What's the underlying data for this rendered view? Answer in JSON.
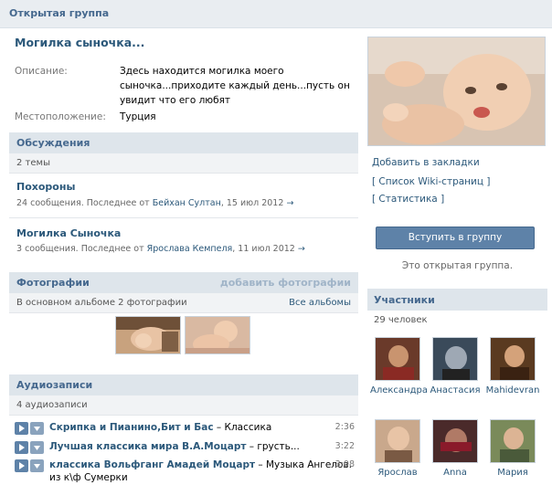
{
  "header": {
    "title": "Открытая группа"
  },
  "group": {
    "name": "Могилка сыночка...",
    "description_label": "Описание:",
    "description_lines": [
      "Здесь находится могилка моего",
      "сыночка...приходите каждый день...пусть он",
      "увидит что его любят"
    ],
    "location_label": "Местоположение:",
    "location": "Турция"
  },
  "discussions": {
    "title": "Обсуждения",
    "count": "2 темы",
    "topics": [
      {
        "title": "Похороны",
        "meta_prefix": "24 сообщения. Последнее от ",
        "author": "Бейхан Султан",
        "date": ", 15 июл 2012",
        "arrow": "→"
      },
      {
        "title": "Могилка Сыночка",
        "meta_prefix": "3 сообщения. Последнее от ",
        "author": "Ярослава Кемпеля",
        "date": ", 11 июл 2012",
        "arrow": "→"
      }
    ]
  },
  "photos": {
    "title": "Фотографии",
    "add_label": "добавить фотографии",
    "summary": "В основном альбоме 2 фотографии",
    "all_label": "Все альбомы"
  },
  "audio": {
    "title": "Аудиозаписи",
    "count": "4 аудиозаписи",
    "tracks": [
      {
        "artist": "Скрипка и Пианино,Бит и Бас",
        "title": " – Классика",
        "duration": "2:36"
      },
      {
        "artist": "Лучшая классика мира В.А.Моцарт",
        "title": " – грусть...",
        "duration": "3:22"
      },
      {
        "artist": "классика Вольфганг Амадей Моцарт",
        "title": " – Музыка Ангелов.",
        "duration": "3:08",
        "extra": "из к\\ф Сумерки"
      }
    ]
  },
  "sidebar": {
    "bookmark": "Добавить в закладки",
    "wiki": "[ Список Wiki-страниц ]",
    "stats": "[ Статистика ]",
    "join": "Вступить в группу",
    "open_note": "Это открытая группа."
  },
  "members": {
    "title": "Участники",
    "count": "29 человек",
    "people": [
      "Александра",
      "Анастасия",
      "Mahidevran",
      "Ярослав",
      "Anna",
      "Мария"
    ]
  },
  "colors": {
    "accent": "#45688e",
    "link": "#2b587a",
    "section_bg": "#dee5eb",
    "button": "#5e82a8"
  },
  "icons": [
    "play-icon",
    "plus-icon",
    "arrow-right-icon"
  ]
}
